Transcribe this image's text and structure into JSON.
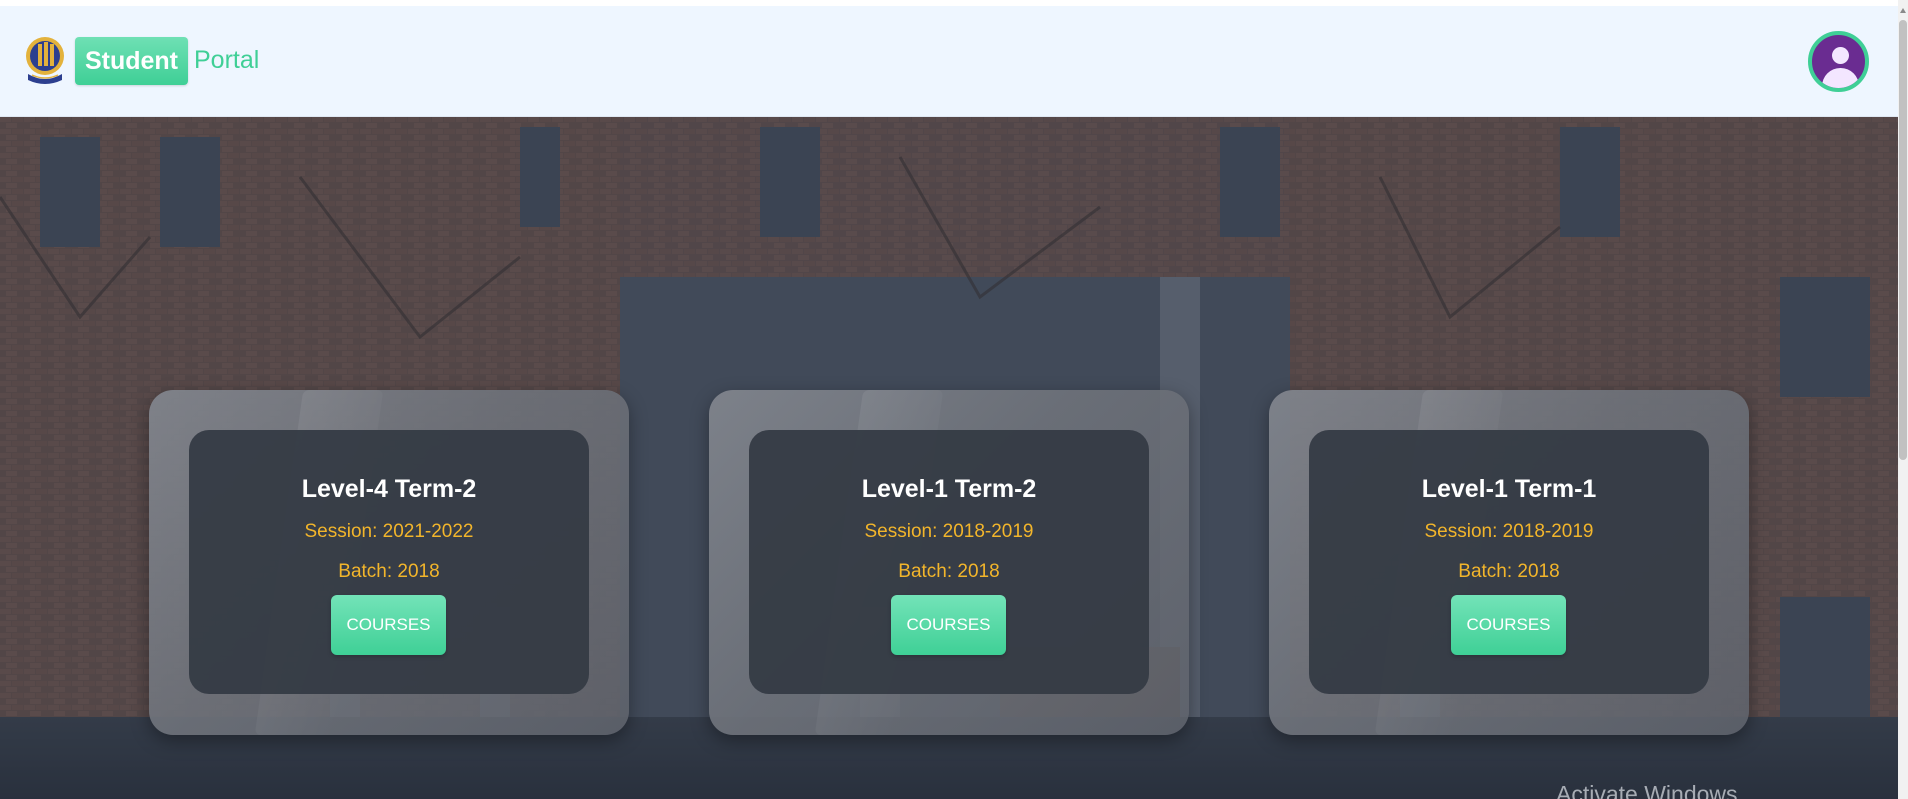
{
  "header": {
    "brand_badge": "Student",
    "brand_word": "Portal",
    "logo_icon": "university-crest-icon",
    "avatar_icon": "user-avatar-icon"
  },
  "cards": [
    {
      "title": "Level-4 Term-2",
      "session": "Session: 2021-2022",
      "batch": "Batch: 2018",
      "button": "COURSES"
    },
    {
      "title": "Level-1 Term-2",
      "session": "Session: 2018-2019",
      "batch": "Batch: 2018",
      "button": "COURSES"
    },
    {
      "title": "Level-1 Term-1",
      "session": "Session: 2018-2019",
      "batch": "Batch: 2018",
      "button": "COURSES"
    }
  ],
  "watermark": "Activate Windows",
  "colors": {
    "accent": "#3fcf96",
    "navbar_bg": "#eef6ff",
    "card_text_highlight": "#f2b52b",
    "avatar_bg": "#6a2c91"
  }
}
